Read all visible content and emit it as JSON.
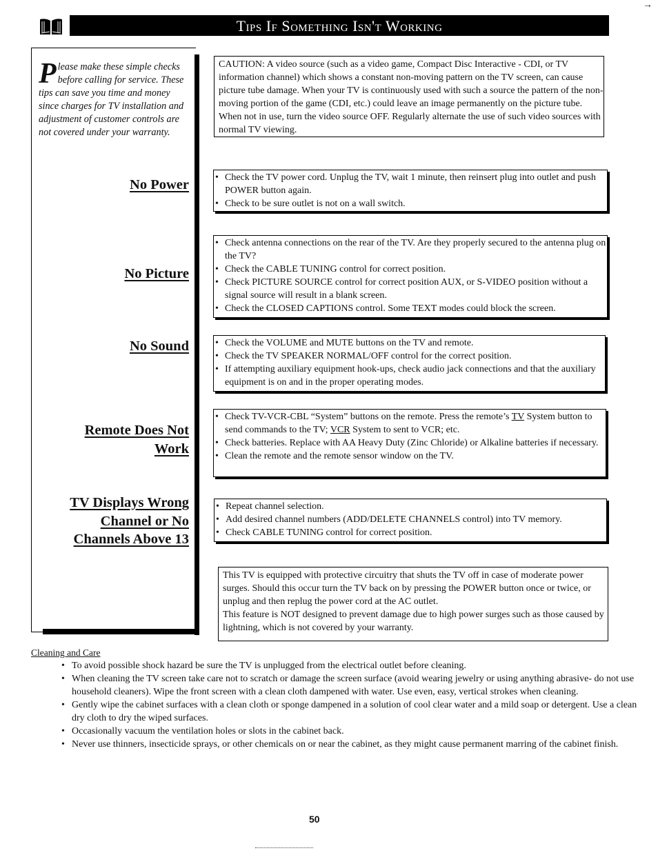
{
  "header": {
    "title": "Tips If Something Isn't Working",
    "icon": "open-book-icon"
  },
  "intro": {
    "drop_cap": "P",
    "text": "lease make these simple checks before calling for service.  These tips can save you time and money since charges for TV installation and adjustment of customer controls are not covered under your warranty."
  },
  "caution": {
    "text": "CAUTION: A video source (such as a video game, Compact Disc Interactive - CDI, or TV information channel) which shows a constant non-moving pattern on the TV screen, can cause picture tube damage. When your TV is continuously used with such a source the pattern of the non-moving portion of the game (CDI, etc.) could leave an image permanently on the picture tube. When not in use, turn the video source OFF. Regularly alternate the use of such video sources with normal TV viewing."
  },
  "sections": [
    {
      "heading": "No Power",
      "items": [
        "Check the TV power cord. Unplug the TV, wait 1 minute, then reinsert plug into outlet and push POWER button again.",
        "Check to be sure outlet is not on a wall switch."
      ]
    },
    {
      "heading": "No Picture",
      "items": [
        "Check antenna connections on the rear of the TV. Are they properly secured to the antenna plug on the TV?",
        "Check the CABLE TUNING control for correct position.",
        "Check PICTURE SOURCE control for correct position AUX, or S-VIDEO position without a signal source will result in a blank screen.",
        "Check the CLOSED CAPTIONS control. Some TEXT modes could block the screen."
      ]
    },
    {
      "heading": "No Sound",
      "items": [
        "Check the VOLUME and MUTE buttons on the TV and remote.",
        "Check the TV SPEAKER NORMAL/OFF control for the correct position.",
        "If attempting auxiliary equipment hook-ups, check audio jack connections and that the auxiliary equipment is on and in the proper operating modes."
      ]
    },
    {
      "heading_line1": "Remote Does Not",
      "heading_line2": "Work",
      "items": [
        {
          "a": "Check TV-VCR-CBL “System” buttons on the remote. Press the remote’s ",
          "u1": "TV",
          "b": " System button to send commands to the TV; ",
          "u2": "VCR",
          "c": " System to sent to VCR; etc."
        },
        "Check batteries.  Replace with AA Heavy Duty (Zinc Chloride) or Alkaline batteries if necessary.",
        "Clean the remote and the remote sensor window on the TV."
      ]
    },
    {
      "heading_line1": "TV Displays Wrong",
      "heading_line2": "Channel or No",
      "heading_line3": "Channels Above 13",
      "items": [
        "Repeat channel selection.",
        "Add desired channel numbers (ADD/DELETE CHANNELS control) into TV memory.",
        "Check CABLE TUNING control for correct position."
      ]
    }
  ],
  "surge_note": {
    "line1": "This TV is equipped with protective circuitry that shuts the TV off in case of moderate power surges. Should this occur turn the TV back on by pressing the POWER button once or twice, or unplug and then replug the power cord at the AC outlet.",
    "line2": "This feature is NOT designed to prevent damage due to high power surges such as those caused by lightning, which is not covered by your warranty."
  },
  "cleaning": {
    "title": "Cleaning and Care",
    "items": [
      "To avoid possible shock hazard be sure the TV is unplugged from the electrical outlet before cleaning.",
      "When cleaning the TV screen take care not to scratch or damage the screen surface (avoid wearing jewelry or using anything abrasive- do not use household cleaners). Wipe the front screen with a clean cloth dampened with water.  Use even, easy, vertical strokes when cleaning.",
      "Gently wipe the cabinet surfaces with a clean cloth or sponge dampened in a solution of cool clear water and a mild soap or detergent. Use a clean dry cloth to dry the wiped surfaces.",
      "Occasionally vacuum the ventilation holes or slots in the cabinet back.",
      "Never use thinners, insecticide sprays, or other chemicals on or near the cabinet, as they might cause permanent marring of the cabinet finish."
    ]
  },
  "footer": {
    "page_number": "50"
  }
}
